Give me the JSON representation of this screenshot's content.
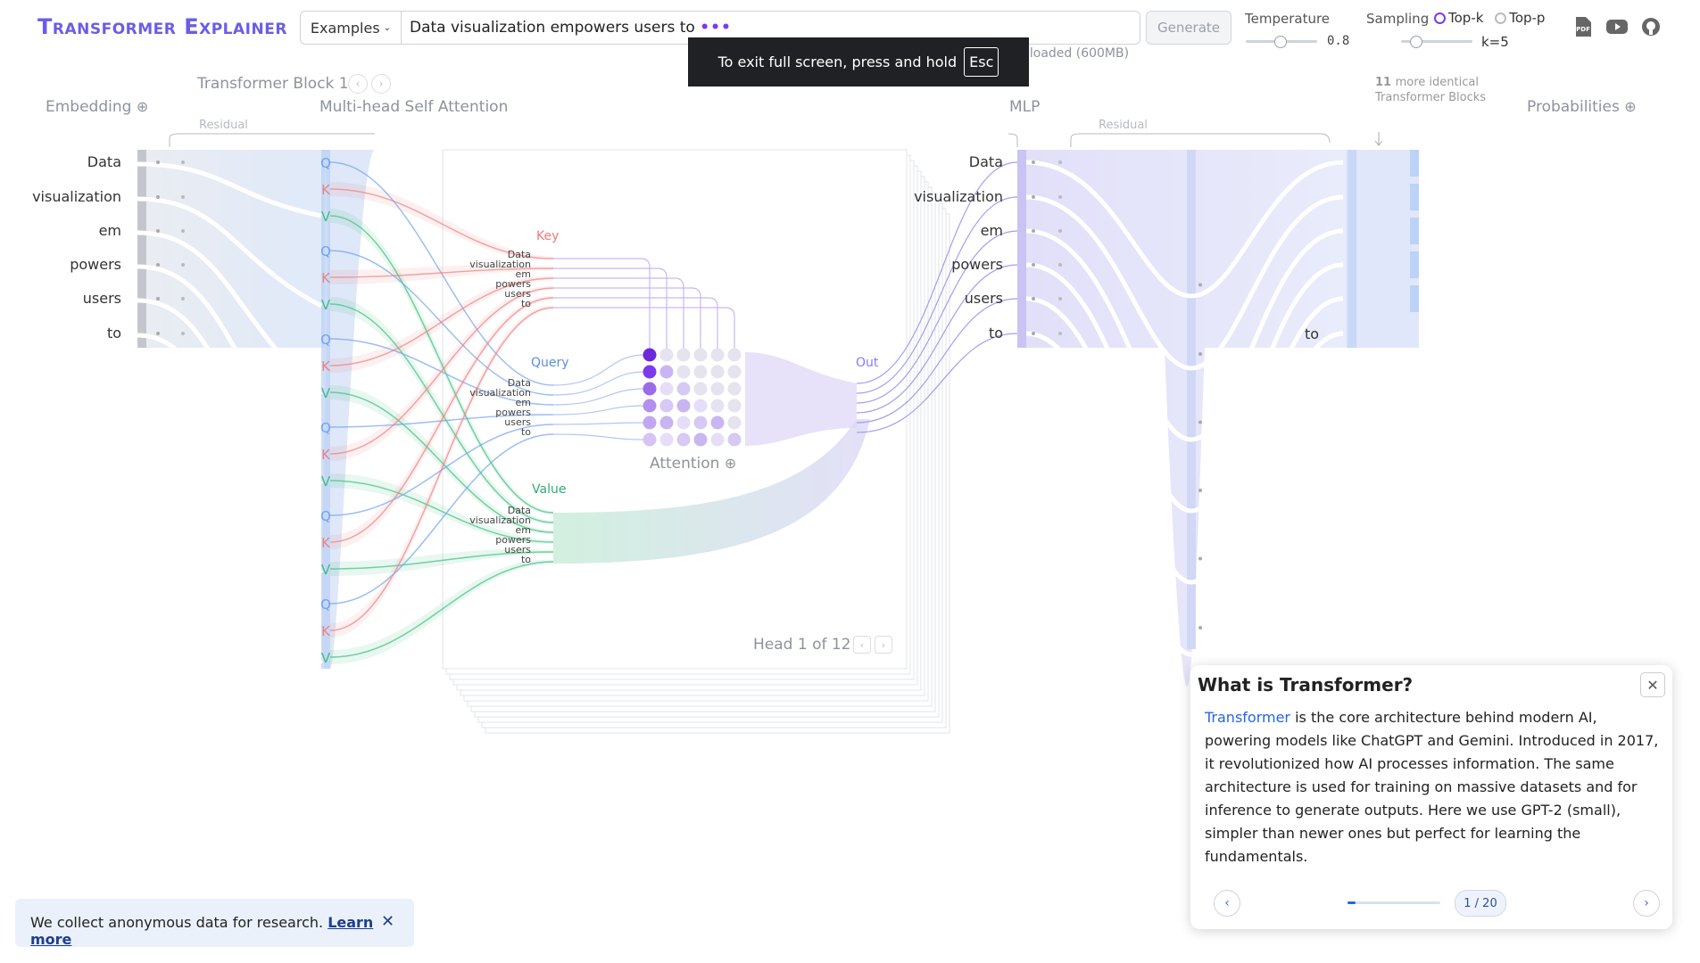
{
  "app": {
    "title": "Transformer Explainer"
  },
  "header": {
    "examples_label": "Examples",
    "prompt_value": "Data visualization empowers users to",
    "prompt_dots": "•••",
    "generate_label": "Generate",
    "temperature_label": "Temperature",
    "temperature_value": "0.8",
    "temperature_fraction": 0.2,
    "sampling_label": "Sampling",
    "sampling_options": [
      "Top-k",
      "Top-p"
    ],
    "sampling_selected": "Top-k",
    "k_value": "k=5",
    "k_fraction": 0.1,
    "model_hint": "nloaded (600MB)",
    "icons": [
      "pdf-icon",
      "youtube-icon",
      "github-icon"
    ],
    "pdf_text": "PDF"
  },
  "fullscreen_toast": {
    "text": "To exit full screen, press and hold",
    "key": "Esc"
  },
  "diagram": {
    "block_label": "Transformer Block 1",
    "embedding_label": "Embedding",
    "attention_section_label": "Multi-head Self Attention",
    "mlp_label": "MLP",
    "probabilities_label": "Probabilities",
    "residual_label": "Residual",
    "more_blocks": {
      "count": "11",
      "text": "more identical Transformer Blocks"
    },
    "tokens": [
      "Data",
      "visualization",
      "em",
      "powers",
      "users",
      "to"
    ],
    "output_token": "to",
    "qkv": [
      "Q",
      "K",
      "V"
    ],
    "key_label": "Key",
    "query_label": "Query",
    "value_label": "Value",
    "out_label": "Out",
    "attention_label": "Attention",
    "head_label": "Head 1 of 12",
    "colors": {
      "query": "#6fa3f0",
      "key": "#f08080",
      "value": "#40c080",
      "attention": "#7c3aed",
      "mlp": "#b9b5f5"
    }
  },
  "notes": {
    "title": "What is Transformer?",
    "link_word": "Transformer",
    "body": " is the core architecture behind modern AI, powering models like ChatGPT and Gemini. Introduced in 2017, it revolutionized how AI processes information. The same architecture is used for training on massive datasets and for inference to generate outputs. Here we use GPT-2 (small), simpler than newer ones but perfect for learning the fundamentals.",
    "counter": "1 / 20",
    "progress_fraction": 0.05
  },
  "cookie": {
    "text": "We collect anonymous data for research.",
    "link": "Learn more"
  }
}
